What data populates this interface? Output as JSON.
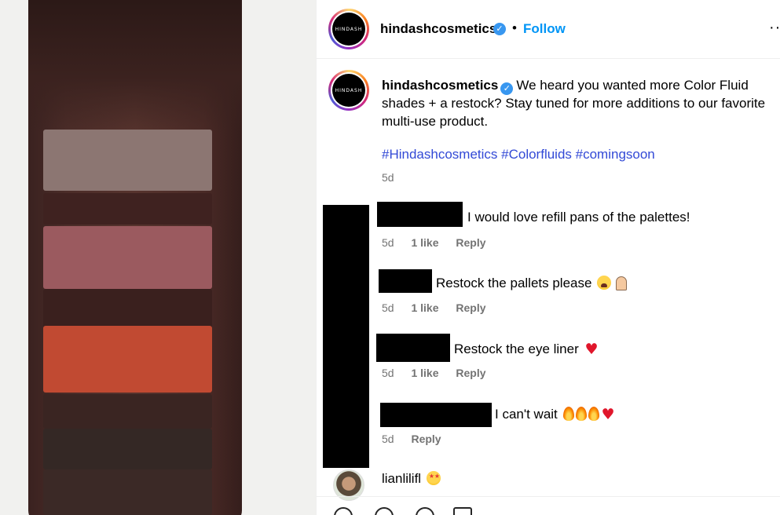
{
  "post": {
    "account": "hindashcosmetics",
    "avatar_text": "HINDASH",
    "verified_icon": "verified-badge-icon",
    "follow_separator": "•",
    "follow_label": "Follow",
    "more_label": "··"
  },
  "caption": {
    "username": "hindashcosmetics",
    "text": "We heard you wanted more Color Fluid shades + a restock? Stay tuned for more additions to our favorite multi-use product.",
    "hashtags": [
      "#Hindashcosmetics",
      "#Colorfluids",
      "#comingsoon"
    ],
    "time": "5d"
  },
  "comments": [
    {
      "text": "I would love refill pans of the palettes!",
      "time": "5d",
      "likes": "1 like",
      "reply": "Reply"
    },
    {
      "text": "Restock the pallets please",
      "time": "5d",
      "likes": "1 like",
      "reply": "Reply"
    },
    {
      "text": "Restock the eye liner",
      "time": "5d",
      "likes": "1 like",
      "reply": "Reply"
    },
    {
      "text": "I can't wait",
      "time": "5d",
      "reply": "Reply"
    },
    {
      "username": "lianlilifl"
    }
  ],
  "colors": {
    "follow_blue": "#0095f6",
    "hashtag_blue": "#3249d6",
    "verified_blue": "#3897f0",
    "meta_gray": "#737373",
    "heart_red": "#e0162b"
  }
}
